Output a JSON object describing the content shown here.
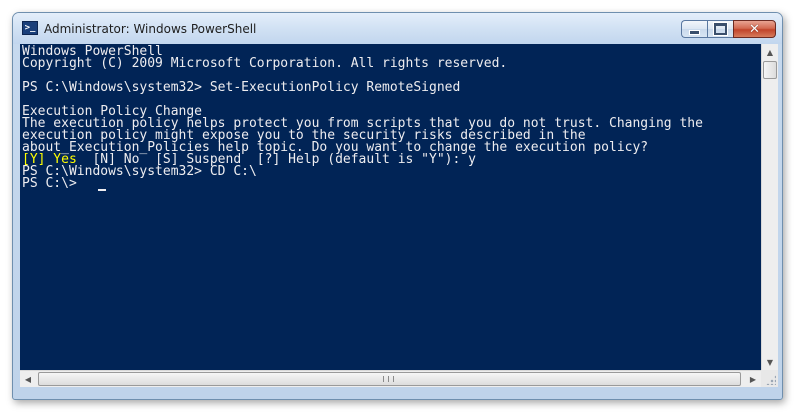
{
  "window": {
    "title": "Administrator: Windows PowerShell",
    "app_icon": "powershell-icon",
    "icon_glyph": ">_",
    "minimize_icon": "minimize-icon",
    "maximize_icon": "maximize-icon",
    "close_icon": "close-icon",
    "close_glyph": "✕"
  },
  "colors": {
    "console_background": "#012456",
    "console_text": "#eeedf0",
    "highlight_text": "#ffff00"
  },
  "console": {
    "lines": [
      "Windows PowerShell",
      "Copyright (C) 2009 Microsoft Corporation. All rights reserved.",
      "",
      "PS C:\\Windows\\system32> Set-ExecutionPolicy RemoteSigned",
      "",
      "Execution Policy Change",
      "The execution policy helps protect you from scripts that you do not trust. Changing the",
      "execution policy might expose you to the security risks described in the",
      "about_Execution_Policies help topic. Do you want to change the execution policy?",
      "",
      "PS C:\\Windows\\system32> CD C:\\",
      "PS C:\\>"
    ],
    "choice_prompt": {
      "highlighted": "[Y] Yes",
      "rest": "  [N] No  [S] Suspend  [?] Help (default is \"Y\"): y"
    }
  },
  "scrollbars": {
    "up_arrow": "▲",
    "down_arrow": "▼",
    "left_arrow": "◀",
    "right_arrow": "▶"
  }
}
